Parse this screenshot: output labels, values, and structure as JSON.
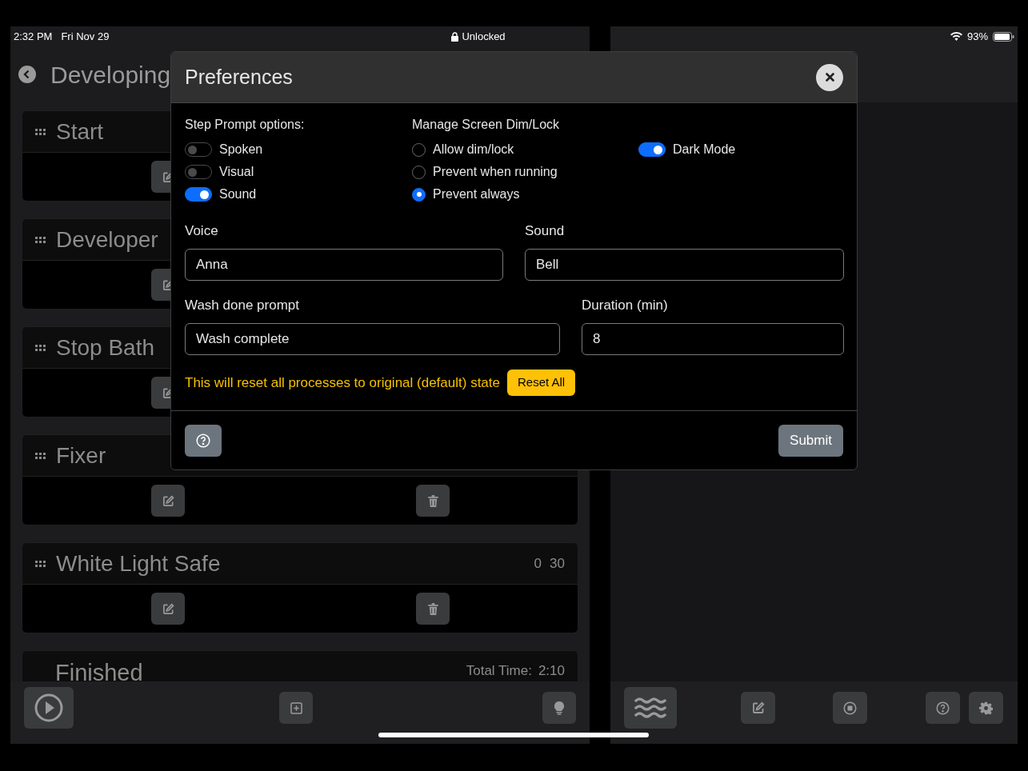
{
  "status_bar": {
    "time": "2:32 PM",
    "date": "Fri Nov 29",
    "lock": "Unlocked",
    "battery": "93%"
  },
  "left_panel": {
    "title": "Developing",
    "steps": [
      {
        "name": "Start"
      },
      {
        "name": "Developer"
      },
      {
        "name": "Stop Bath"
      },
      {
        "name": "Fixer"
      },
      {
        "name": "White Light Safe",
        "times": [
          "0",
          "30"
        ]
      }
    ],
    "finished": {
      "label": "Finished",
      "total_label": "Total Time:",
      "total": "2:10"
    }
  },
  "dialog": {
    "title": "Preferences",
    "step_prompt": {
      "heading": "Step Prompt options:",
      "options": [
        {
          "label": "Spoken",
          "on": false
        },
        {
          "label": "Visual",
          "on": false
        },
        {
          "label": "Sound",
          "on": true
        }
      ]
    },
    "screen_lock": {
      "heading": "Manage Screen Dim/Lock",
      "options": [
        {
          "label": "Allow dim/lock",
          "selected": false
        },
        {
          "label": "Prevent when running",
          "selected": false
        },
        {
          "label": "Prevent always",
          "selected": true
        }
      ]
    },
    "dark_mode": {
      "label": "Dark Mode",
      "on": true
    },
    "fields": [
      {
        "label": "Voice",
        "value": "Anna"
      },
      {
        "label": "Sound",
        "value": "Bell"
      },
      {
        "label": "Wash done prompt",
        "value": "Wash complete"
      },
      {
        "label": "Duration (min)",
        "value": "8"
      }
    ],
    "warning": "This will reset all processes to original (default) state",
    "reset_button": "Reset All",
    "submit_button": "Submit"
  }
}
